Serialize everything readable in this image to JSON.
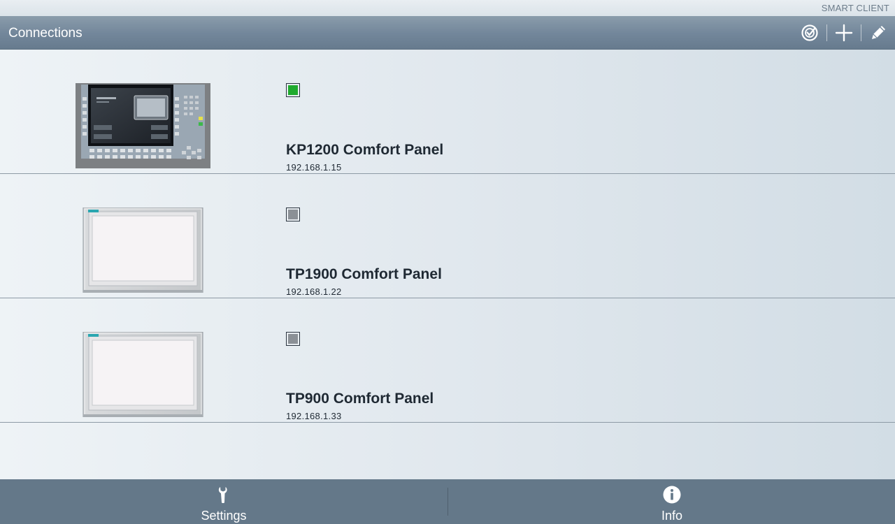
{
  "app": {
    "brand": "SMART CLIENT"
  },
  "toolbar": {
    "title": "Connections",
    "actions": [
      {
        "name": "connect",
        "icon": "connect-check-icon"
      },
      {
        "name": "add",
        "icon": "plus-icon"
      },
      {
        "name": "edit",
        "icon": "pencil-icon"
      }
    ]
  },
  "connections": [
    {
      "name": "KP1200 Comfort Panel",
      "ip": "192.168.1.15",
      "status": "connected",
      "status_color": "#1faa2e",
      "device": "keypanel"
    },
    {
      "name": "TP1900 Comfort Panel",
      "ip": "192.168.1.22",
      "status": "disconnected",
      "status_color": "#8b9096",
      "device": "touchpanel"
    },
    {
      "name": "TP900 Comfort Panel",
      "ip": "192.168.1.33",
      "status": "disconnected",
      "status_color": "#8b9096",
      "device": "touchpanel"
    }
  ],
  "bottom_bar": {
    "settings_label": "Settings",
    "settings_icon": "wrench-icon",
    "info_label": "Info",
    "info_icon": "info-icon"
  },
  "colors": {
    "toolbar": "#72869a",
    "bottom_bar": "#647889",
    "accent_teal": "#2aa6b0",
    "status_connected": "#1faa2e",
    "status_disconnected": "#8b9096"
  }
}
